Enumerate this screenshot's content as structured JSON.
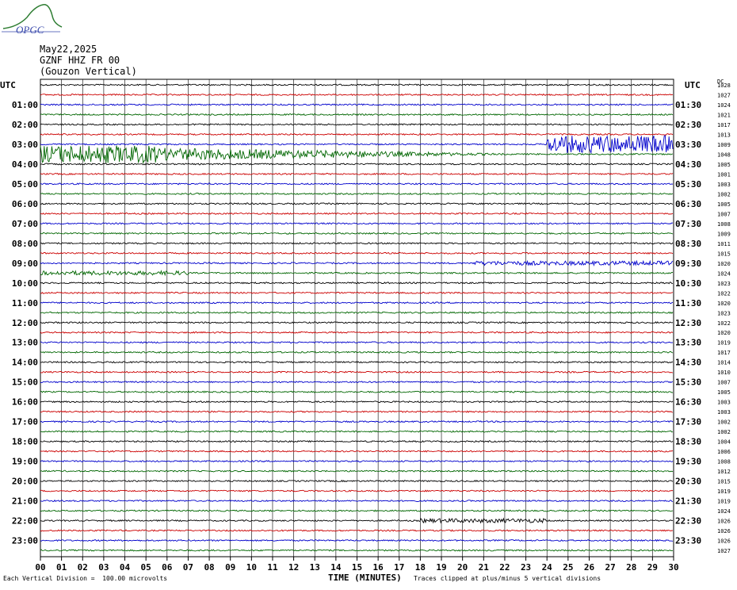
{
  "logo": {
    "text": "OPGC",
    "icon": "opgc-mountain-logo"
  },
  "header": {
    "date": "May22,2025",
    "station": "GZNF HHZ FR 00",
    "location": "(Gouzon Vertical)"
  },
  "colors": {
    "trace_cycle": [
      "#000000",
      "#cc0000",
      "#0000cc",
      "#006600"
    ],
    "grid": "#000000"
  },
  "chart_data": {
    "type": "line",
    "title": "",
    "left_axis_label": "UTC",
    "right_axis_label": "UTC",
    "right_extra_label": "DC",
    "xlabel": "TIME (MINUTES)",
    "xlim": [
      0,
      30
    ],
    "x_ticks": [
      "00",
      "01",
      "02",
      "03",
      "04",
      "05",
      "06",
      "07",
      "08",
      "09",
      "10",
      "11",
      "12",
      "13",
      "14",
      "15",
      "16",
      "17",
      "18",
      "19",
      "20",
      "21",
      "22",
      "23",
      "24",
      "25",
      "26",
      "27",
      "28",
      "29",
      "30"
    ],
    "left_hour_labels": [
      "01:00",
      "02:00",
      "03:00",
      "04:00",
      "05:00",
      "06:00",
      "07:00",
      "08:00",
      "09:00",
      "10:00",
      "11:00",
      "12:00",
      "13:00",
      "14:00",
      "15:00",
      "16:00",
      "17:00",
      "18:00",
      "19:00",
      "20:00",
      "21:00",
      "22:00",
      "23:00"
    ],
    "right_hour_labels": [
      "01:30",
      "02:30",
      "03:30",
      "04:30",
      "05:30",
      "06:30",
      "07:30",
      "08:30",
      "09:30",
      "10:30",
      "11:30",
      "12:30",
      "13:30",
      "14:30",
      "15:30",
      "16:30",
      "17:30",
      "18:30",
      "19:30",
      "20:30",
      "21:30",
      "22:30",
      "23:30"
    ],
    "dc_offsets": [
      "1028",
      "1027",
      "1024",
      "1021",
      "1017",
      "1013",
      "1009",
      "1048",
      "1005",
      "1001",
      "1003",
      "1002",
      "1005",
      "1007",
      "1008",
      "1009",
      "1011",
      "1015",
      "1020",
      "1024",
      "1023",
      "1022",
      "1020",
      "1023",
      "1022",
      "1020",
      "1019",
      "1017",
      "1014",
      "1010",
      "1007",
      "1005",
      "1003",
      "1003",
      "1002",
      "1002",
      "1004",
      "1006",
      "1008",
      "1012",
      "1015",
      "1019",
      "1019",
      "1024",
      "1026",
      "1026",
      "1026",
      "1027"
    ],
    "trace_count": 48,
    "events": [
      {
        "trace": 7,
        "x_start": 0,
        "x_end": 5.5,
        "amplitude": "high",
        "decay_to": 22
      },
      {
        "trace": 6,
        "x_start": 24,
        "x_end": 30,
        "amplitude": "high"
      },
      {
        "trace": 18,
        "x_start": 20.5,
        "x_end": 30,
        "amplitude": "low"
      },
      {
        "trace": 19,
        "x_start": 0,
        "x_end": 7,
        "amplitude": "low"
      },
      {
        "trace": 44,
        "x_start": 18,
        "x_end": 24,
        "amplitude": "low"
      }
    ]
  },
  "footer": {
    "left": "Each Vertical Division =  100.00 microvolts",
    "right": "Traces clipped at plus/minus 5 vertical divisions"
  }
}
